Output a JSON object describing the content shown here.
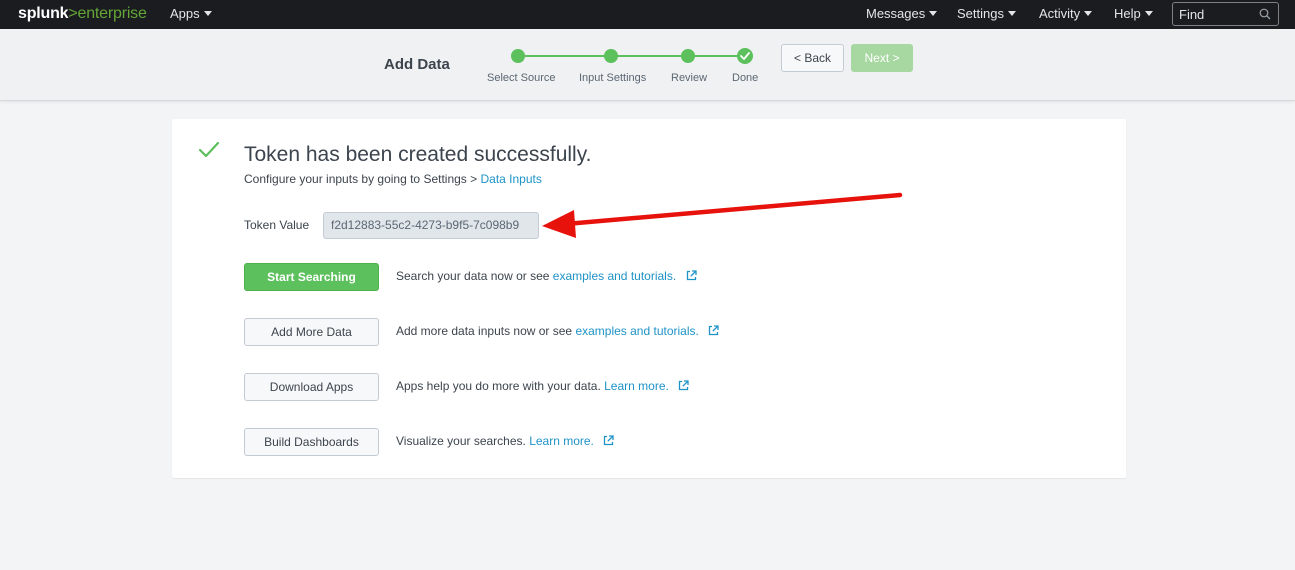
{
  "topbar": {
    "logo": {
      "brand": "splunk",
      "separator": ">",
      "product": "enterprise"
    },
    "apps_label": "Apps",
    "messages_label": "Messages",
    "settings_label": "Settings",
    "activity_label": "Activity",
    "help_label": "Help",
    "find_placeholder": "Find"
  },
  "wizard": {
    "title": "Add Data",
    "steps": [
      {
        "label": "Select Source",
        "state": "complete"
      },
      {
        "label": "Input Settings",
        "state": "complete"
      },
      {
        "label": "Review",
        "state": "complete"
      },
      {
        "label": "Done",
        "state": "current"
      }
    ],
    "back_label": "< Back",
    "next_label": "Next >"
  },
  "card": {
    "title": "Token has been created successfully.",
    "subtitle_prefix": "Configure your inputs by going to Settings > ",
    "subtitle_link": "Data Inputs",
    "token_label": "Token Value",
    "token_value": "f2d12883-55c2-4273-b9f5-7c098b9",
    "actions": [
      {
        "button": "Start Searching",
        "desc": "Search your data now or see ",
        "link": "examples and tutorials.",
        "style": "primary"
      },
      {
        "button": "Add More Data",
        "desc": "Add more data inputs now or see ",
        "link": "examples and tutorials.",
        "style": "default"
      },
      {
        "button": "Download Apps",
        "desc": "Apps help you do more with your data. ",
        "link": "Learn more.",
        "style": "default"
      },
      {
        "button": "Build Dashboards",
        "desc": "Visualize your searches. ",
        "link": "Learn more.",
        "style": "default"
      }
    ]
  },
  "colors": {
    "accent_green": "#5cc05c",
    "link_blue": "#1e93c6",
    "annotation_red": "#e8120c",
    "topbar_bg": "#1a1c20"
  }
}
